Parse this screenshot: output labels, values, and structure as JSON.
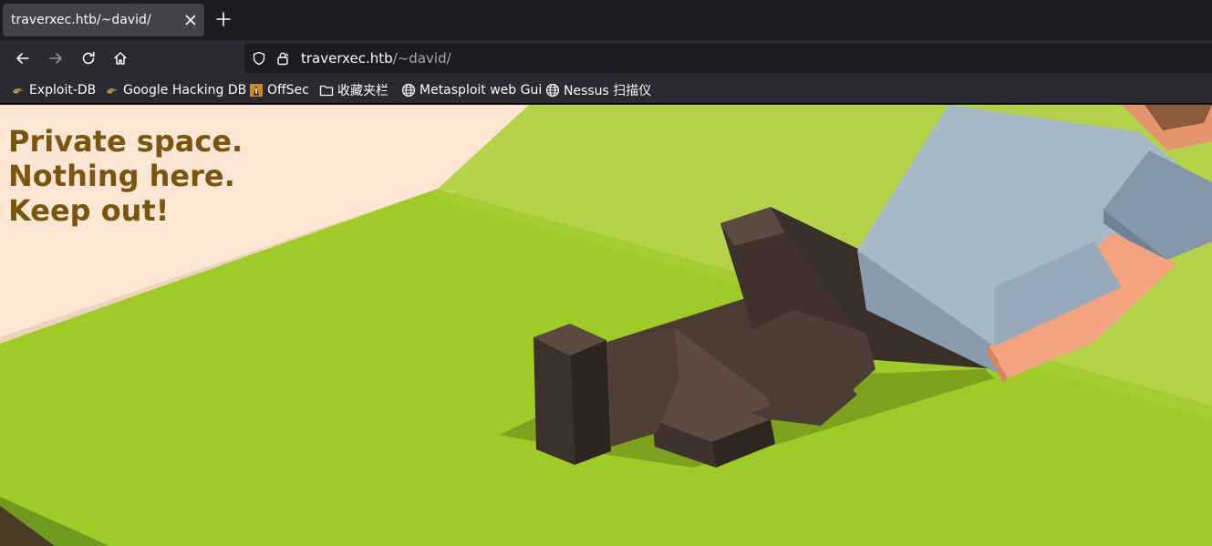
{
  "tab": {
    "title": "traverxec.htb/~david/"
  },
  "url": {
    "host": "traverxec.htb",
    "path": "/~david/"
  },
  "bookmarks": [
    {
      "label": "Exploit-DB",
      "icon": "exploitdb-icon"
    },
    {
      "label": "Google Hacking DB",
      "icon": "ghdb-icon"
    },
    {
      "label": "OffSec",
      "icon": "offsec-icon"
    },
    {
      "label": "收藏夹栏",
      "icon": "folder-icon"
    },
    {
      "label": "Metasploit web Gui",
      "icon": "globe-icon"
    },
    {
      "label": "Nessus 扫描仪",
      "icon": "globe-icon"
    }
  ],
  "page": {
    "heading_lines": [
      "Private space.",
      "Nothing here.",
      "Keep out!"
    ]
  },
  "colors": {
    "heading": "#7a5510",
    "grass": "#9ccc2a",
    "wall": "#fde6d4",
    "back_grass": "#b4d44a"
  }
}
